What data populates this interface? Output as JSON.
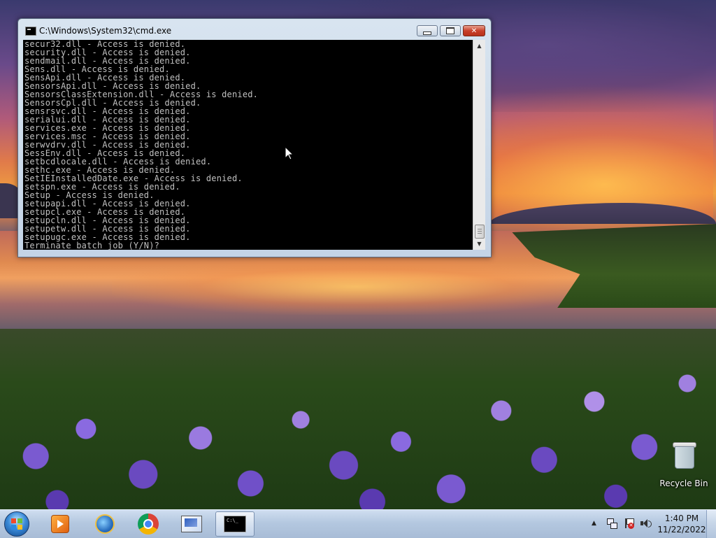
{
  "window": {
    "title": "C:\\Windows\\System32\\cmd.exe",
    "console_lines": [
      "secur32.dll - Access is denied.",
      "security.dll - Access is denied.",
      "sendmail.dll - Access is denied.",
      "Sens.dll - Access is denied.",
      "SensApi.dll - Access is denied.",
      "SensorsApi.dll - Access is denied.",
      "SensorsClassExtension.dll - Access is denied.",
      "SensorsCpl.dll - Access is denied.",
      "sensrsvc.dll - Access is denied.",
      "serialui.dll - Access is denied.",
      "services.exe - Access is denied.",
      "services.msc - Access is denied.",
      "serwvdrv.dll - Access is denied.",
      "SessEnv.dll - Access is denied.",
      "setbcdlocale.dll - Access is denied.",
      "sethc.exe - Access is denied.",
      "SetIEInstalledDate.exe - Access is denied.",
      "setspn.exe - Access is denied.",
      "Setup - Access is denied.",
      "setupapi.dll - Access is denied.",
      "setupcl.exe - Access is denied.",
      "setupcln.dll - Access is denied.",
      "setupetw.dll - Access is denied.",
      "setupugc.exe - Access is denied.",
      "Terminate batch job (Y/N)?"
    ],
    "scroll_position": 0.93,
    "colors": {
      "console_bg": "#000000",
      "console_fg": "#c0c0c0"
    }
  },
  "desktop": {
    "icons": [
      {
        "label": "Recycle Bin",
        "icon": "recycle-bin-icon"
      }
    ]
  },
  "taskbar": {
    "start_icon": "windows-start-orb-icon",
    "pinned": [
      {
        "icon": "windows-media-player-icon"
      },
      {
        "icon": "internet-explorer-icon"
      },
      {
        "icon": "chrome-icon"
      },
      {
        "icon": "computer-icon"
      },
      {
        "icon": "cmd-icon",
        "active": true,
        "glyph": "C:\\_"
      }
    ],
    "tray": {
      "time": "1:40 PM",
      "date": "11/22/2022"
    }
  }
}
